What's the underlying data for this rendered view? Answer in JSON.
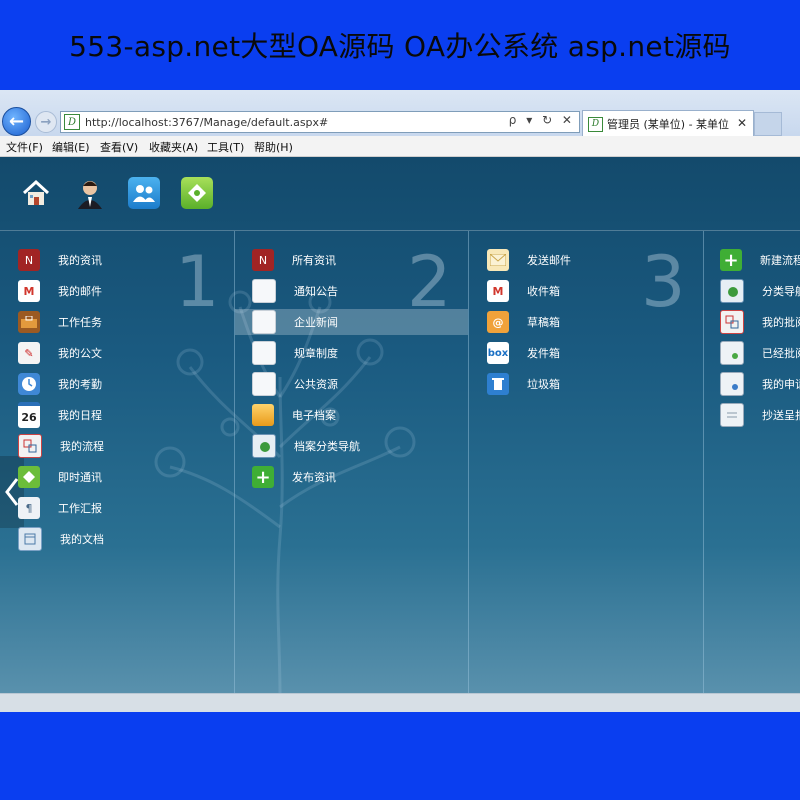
{
  "banner": {
    "text": "553-asp.net大型OA源码 OA办公系统 asp.net源码"
  },
  "browser": {
    "url": "http://localhost:3767/Manage/default.aspx#",
    "address_tools": "ρ ▾ ↻ ✕",
    "tab_title": "管理员 (某单位) - 某单位",
    "tab_close": "✕",
    "back_glyph": "←",
    "forward_glyph": "→",
    "favicon_letter": "D",
    "menu": [
      "文件(F)",
      "编辑(E)",
      "查看(V)",
      "收藏夹(A)",
      "工具(T)",
      "帮助(H)"
    ]
  },
  "toolbar": {
    "icons": [
      "home-icon",
      "user-avatar-icon",
      "contacts-icon",
      "chat-icon"
    ]
  },
  "columns": [
    {
      "number": "1",
      "items": [
        {
          "label": "我的资讯",
          "icon": "news-icon"
        },
        {
          "label": "我的邮件",
          "icon": "gmail-icon"
        },
        {
          "label": "工作任务",
          "icon": "briefcase-icon"
        },
        {
          "label": "我的公文",
          "icon": "document-edit-icon"
        },
        {
          "label": "我的考勤",
          "icon": "clock-icon"
        },
        {
          "label": "我的日程",
          "icon": "calendar-icon",
          "icon_text": "26"
        },
        {
          "label": "我的流程",
          "icon": "flow-icon"
        },
        {
          "label": "即时通讯",
          "icon": "chat-icon"
        },
        {
          "label": "工作汇报",
          "icon": "report-icon"
        },
        {
          "label": "我的文档",
          "icon": "folder-doc-icon"
        }
      ]
    },
    {
      "number": "2",
      "items": [
        {
          "label": "所有资讯",
          "icon": "news-icon"
        },
        {
          "label": "通知公告",
          "icon": "page-icon"
        },
        {
          "label": "企业新闻",
          "icon": "page-icon",
          "selected": true
        },
        {
          "label": "规章制度",
          "icon": "page-icon"
        },
        {
          "label": "公共资源",
          "icon": "page-icon"
        },
        {
          "label": "电子档案",
          "icon": "archive-icon"
        },
        {
          "label": "档案分类导航",
          "icon": "globe-folder-icon"
        },
        {
          "label": "发布资讯",
          "icon": "add-icon"
        }
      ]
    },
    {
      "number": "3",
      "items": [
        {
          "label": "发送邮件",
          "icon": "envelope-icon"
        },
        {
          "label": "收件箱",
          "icon": "gmail-icon"
        },
        {
          "label": "草稿箱",
          "icon": "at-mail-icon"
        },
        {
          "label": "发件箱",
          "icon": "box-icon",
          "icon_text": "box"
        },
        {
          "label": "垃圾箱",
          "icon": "trash-icon"
        }
      ]
    },
    {
      "number": "",
      "items": [
        {
          "label": "新建流程",
          "icon": "add-icon"
        },
        {
          "label": "分类导航",
          "icon": "globe-folder-icon"
        },
        {
          "label": "我的批阅",
          "icon": "flow-icon"
        },
        {
          "label": "已经批阅",
          "icon": "approved-icon"
        },
        {
          "label": "我的申请",
          "icon": "apply-icon"
        },
        {
          "label": "抄送呈报",
          "icon": "cc-icon"
        }
      ]
    }
  ],
  "colors": {
    "banner": "#0a3ef0",
    "app_top": "#134a6c",
    "app_bottom": "#5f95b0"
  }
}
